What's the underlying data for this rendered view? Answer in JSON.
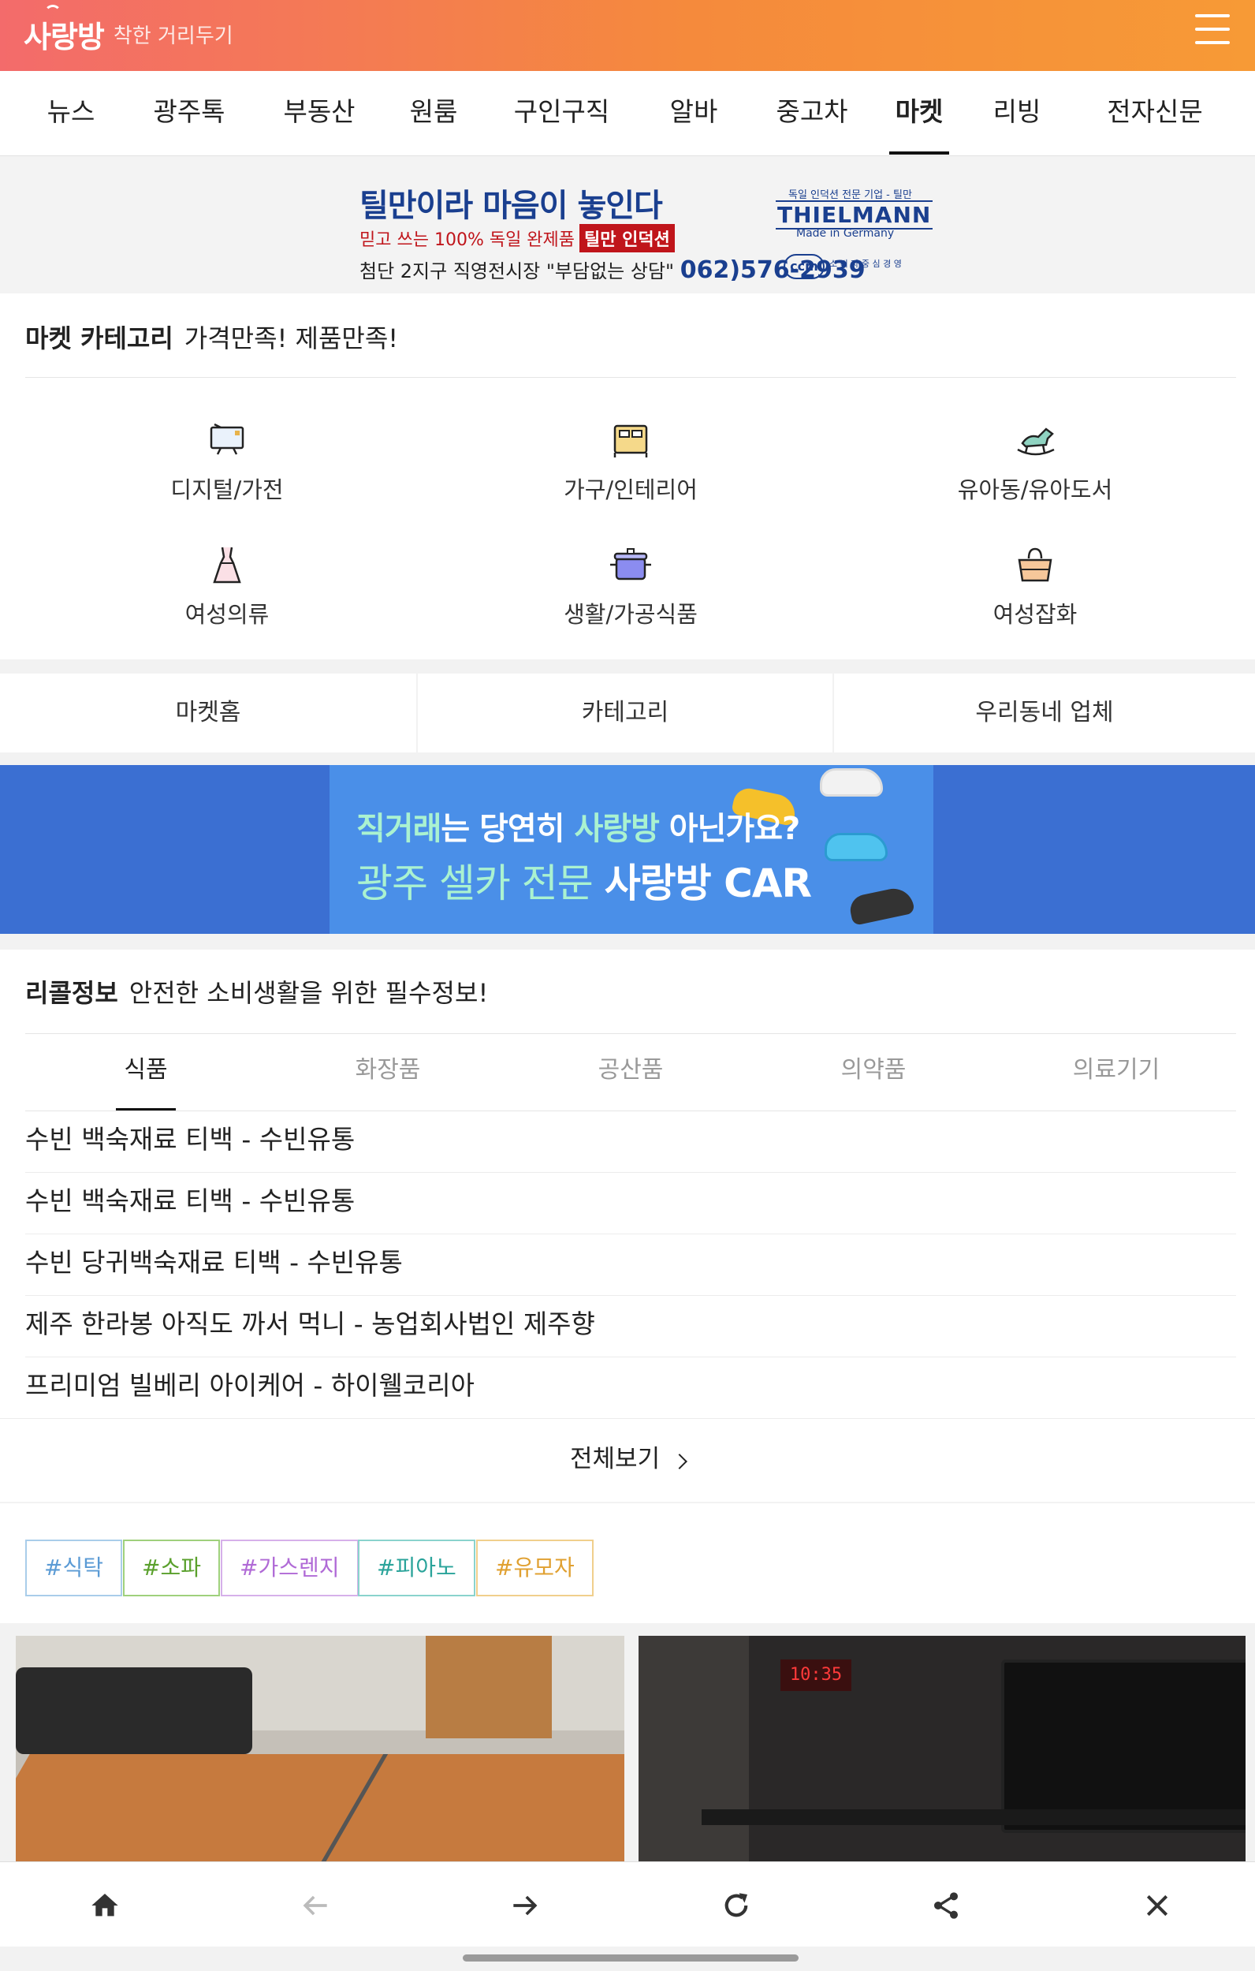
{
  "header": {
    "logo_text": "사랑방",
    "tagline": "착한 거리두기",
    "menu_icon": "hamburger-icon"
  },
  "nav": {
    "items": [
      "뉴스",
      "광주톡",
      "부동산",
      "원룸",
      "구인구직",
      "알바",
      "중고차",
      "마켓",
      "리빙",
      "전자신문"
    ],
    "active": "마켓"
  },
  "ad_banner": {
    "headline": "틸만이라 마음이 놓인다",
    "sub": "믿고 쓰는 100% 독일 완제품",
    "sub_chip": "틸만 인덕션",
    "line": "첨단 2지구 직영전시장 \"부담없는 상담\"",
    "phone": "062)576-2939",
    "brand_small": "독일 인덕션 전문 기업 - 틸만",
    "brand": "THIELMANN",
    "made": "Made in Germany",
    "ccm": "ccm",
    "ccm_text": "소 비 자 중 심 경 영"
  },
  "market_category": {
    "title_bold": "마켓 카테고리",
    "title_rest": "가격만족! 제품만족!",
    "items": [
      {
        "label": "디지털/가전",
        "icon": "tv-icon"
      },
      {
        "label": "가구/인테리어",
        "icon": "bed-icon"
      },
      {
        "label": "유아동/유아도서",
        "icon": "rocking-horse-icon"
      },
      {
        "label": "여성의류",
        "icon": "dress-icon"
      },
      {
        "label": "생활/가공식품",
        "icon": "pot-icon"
      },
      {
        "label": "여성잡화",
        "icon": "handbag-icon"
      }
    ]
  },
  "market_tabs": [
    "마켓홈",
    "카테고리",
    "우리동네 업체"
  ],
  "car_banner": {
    "line1_a": "직거래",
    "line1_b": "는 당연히 ",
    "line1_c": "사랑방",
    "line1_d": " 아닌가요?",
    "line2_a": "광주 셀카 전문 ",
    "line2_b": "사랑방 CAR"
  },
  "recall": {
    "title_bold": "리콜정보",
    "title_rest": "안전한 소비생활을 위한 필수정보!",
    "tabs": [
      "식품",
      "화장품",
      "공산품",
      "의약품",
      "의료기기"
    ],
    "active_tab": "식품",
    "items": [
      "수빈 백숙재료 티백 - 수빈유통",
      "수빈 백숙재료 티백 - 수빈유통",
      "수빈 당귀백숙재료 티백 - 수빈유통",
      "제주 한라봉 아직도 까서 먹니 - 농업회사법인 제주향",
      "프리미엄 빌베리 아이케어 - 하이웰코리아"
    ],
    "view_all": "전체보기"
  },
  "tags": [
    {
      "label": "#식탁",
      "color": "#5b9bd5"
    },
    {
      "label": "#소파",
      "color": "#5aa02c"
    },
    {
      "label": "#가스렌지",
      "color": "#b06ad6"
    },
    {
      "label": "#피아노",
      "color": "#2aa39a"
    },
    {
      "label": "#유모자",
      "color": "#e0a030"
    }
  ],
  "photo_clock": "10:35",
  "bottom_bar": {
    "icons": [
      "home-icon",
      "back-arrow-icon",
      "forward-arrow-icon",
      "refresh-icon",
      "share-icon",
      "close-icon"
    ]
  }
}
